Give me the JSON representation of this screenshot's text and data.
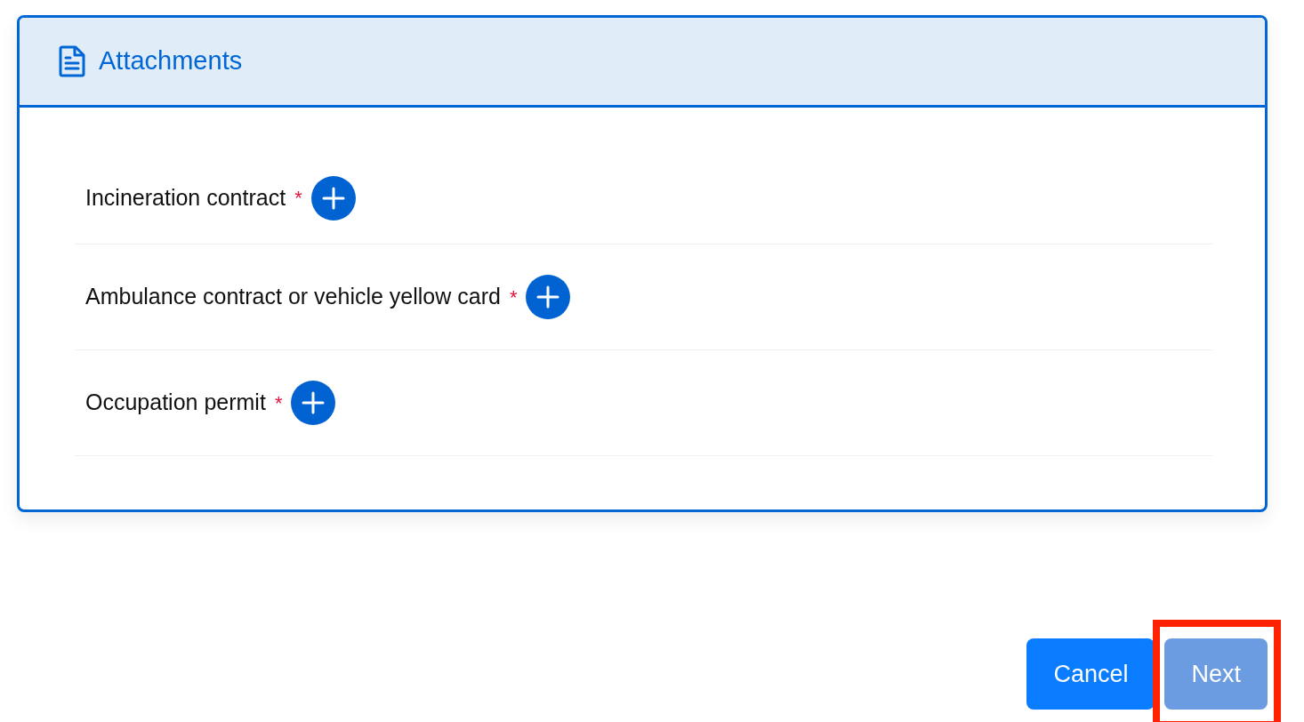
{
  "panel": {
    "title": "Attachments"
  },
  "attachments": [
    {
      "label": "Incineration contract",
      "required_mark": "*"
    },
    {
      "label": "Ambulance contract or vehicle yellow card",
      "required_mark": "*"
    },
    {
      "label": "Occupation permit",
      "required_mark": "*"
    }
  ],
  "buttons": [
    {
      "label": "Cancel",
      "disabled": false,
      "highlighted": false
    },
    {
      "label": "Next",
      "disabled": true,
      "highlighted": true
    }
  ]
}
